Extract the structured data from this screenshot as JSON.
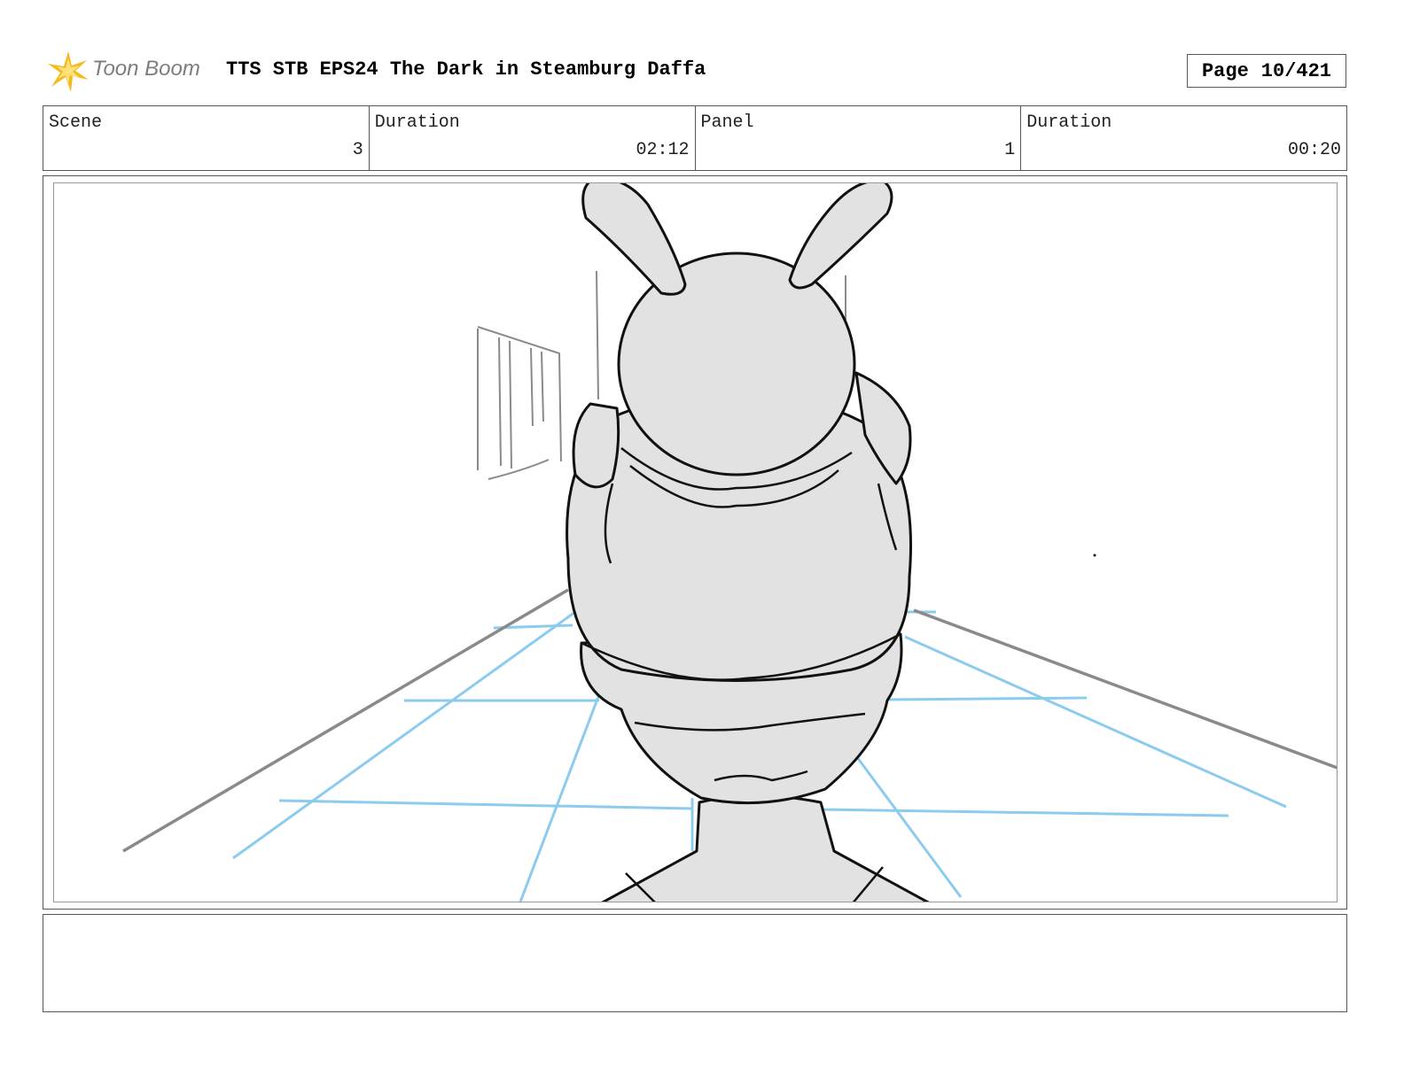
{
  "header": {
    "logo_text": "Toon Boom",
    "title": "TTS STB EPS24 The Dark in Steamburg Daffa",
    "page_label": "Page",
    "page_number": "10/421"
  },
  "info": {
    "scene_label": "Scene",
    "scene_value": "3",
    "scene_duration_label": "Duration",
    "scene_duration_value": "02:12",
    "panel_label": "Panel",
    "panel_value": "1",
    "panel_duration_label": "Duration",
    "panel_duration_value": "00:20"
  },
  "colors": {
    "logo_star": "#f7b81a",
    "guide_lines": "#8ccbee",
    "sketch_gray": "#e2e2e2"
  },
  "notes": {
    "text": ""
  }
}
